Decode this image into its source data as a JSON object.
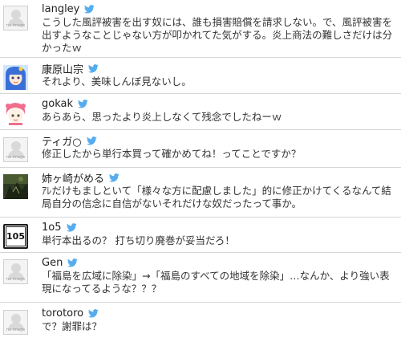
{
  "tweets": [
    {
      "name": "langley",
      "avatar_label": "no image",
      "text": "こうした風評被害を出す奴には、誰も損害賠償を請求しない。で、風評被害を出すようなことじゃない方が叩かれてた気がする。炎上商法の難しさだけは分かったｗ"
    },
    {
      "name": "康原山宗",
      "text": "それより、美味しんぼ見ないし。"
    },
    {
      "name": "gokak",
      "text": "あらあら、思ったより炎上しなくて残念でしたねーｗ"
    },
    {
      "name": "ティガ○",
      "avatar_label": "no image",
      "text": "修正したから単行本買って確かめてね！ってことですか？"
    },
    {
      "name": "姉ヶ崎がめる",
      "text": "ｱﾚだけもましといて「様々な方に配慮しました」的に修正かけてくるなんて結局自分の信念に自信がないそれだけな奴だったって事か。"
    },
    {
      "name": "1o5",
      "avatar_label": "105",
      "text": "単行本出るの？ 打ち切り廃巻が妥当だろ！"
    },
    {
      "name": "Gen",
      "avatar_label": "no image",
      "text": "「福島を広域に除染」→「福島のすべての地域を除染」…なんか、より強い表現になってるような？？？"
    },
    {
      "name": "torotoro",
      "avatar_label": "no image",
      "text": "で？謝罪は？"
    }
  ],
  "colors": {
    "bird": "#55acee",
    "divider": "#d6d6d6",
    "name": "#222222",
    "text": "#333333"
  },
  "icons": {
    "verified_bird": "twitter-bird-icon"
  }
}
